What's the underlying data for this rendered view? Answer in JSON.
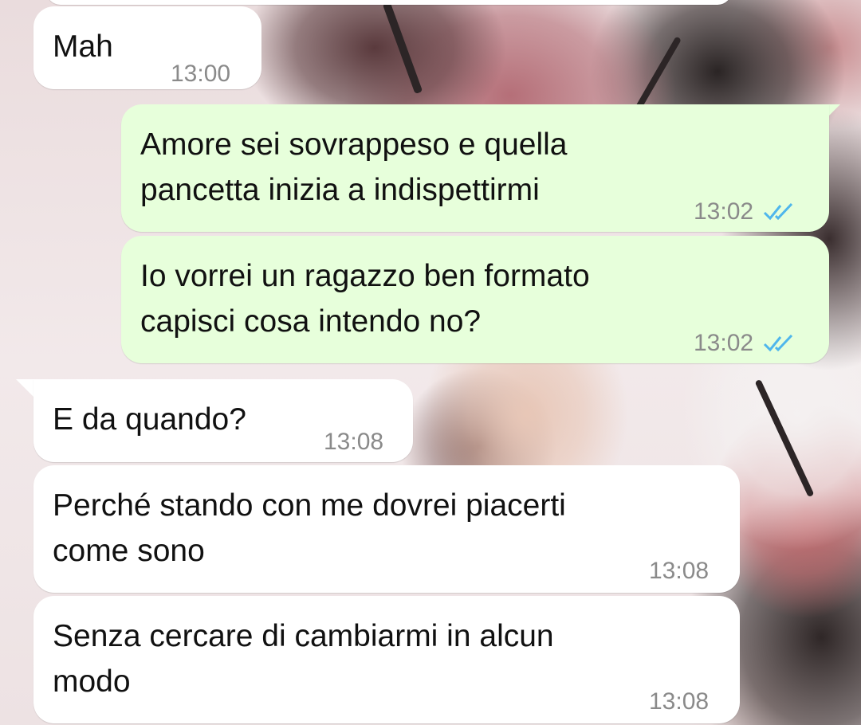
{
  "colors": {
    "incoming_bubble": "#ffffff",
    "outgoing_bubble": "#e7ffdb",
    "timestamp": "#8a8a8a",
    "read_ticks": "#4fb6ec"
  },
  "messages": [
    {
      "direction": "incoming",
      "text": "Mah",
      "time": "13:00"
    },
    {
      "direction": "outgoing",
      "text": "Amore sei sovrappeso e quella\npancetta inizia a indispettirmi",
      "time": "13:02",
      "status": "read",
      "status_icon": "double-check-icon"
    },
    {
      "direction": "outgoing",
      "text": "Io vorrei un ragazzo ben formato\ncapisci cosa intendo no?",
      "time": "13:02",
      "status": "read",
      "status_icon": "double-check-icon"
    },
    {
      "direction": "incoming",
      "text": "E da quando?",
      "time": "13:08"
    },
    {
      "direction": "incoming",
      "text": "Perché stando con me dovrei piacerti\ncome sono",
      "time": "13:08"
    },
    {
      "direction": "incoming",
      "text": "Senza cercare di cambiarmi in alcun\nmodo",
      "time": "13:08"
    }
  ]
}
